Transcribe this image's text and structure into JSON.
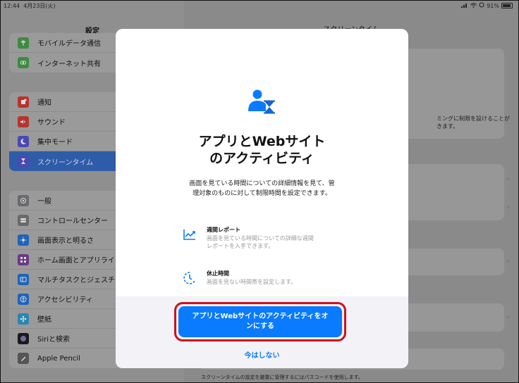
{
  "status_bar": {
    "time": "12:44",
    "date": "4月23日(火)",
    "battery": "91%"
  },
  "sidebar": {
    "title": "設定",
    "group1": [
      {
        "label": "モバイルデータ通信",
        "icon": "antenna-icon",
        "color": "#4caf50"
      },
      {
        "label": "インターネット共有",
        "icon": "link-icon",
        "color": "#4caf50"
      }
    ],
    "group2": [
      {
        "label": "通知",
        "icon": "bell-icon",
        "color": "#e53935"
      },
      {
        "label": "サウンド",
        "icon": "speaker-icon",
        "color": "#e53935"
      },
      {
        "label": "集中モード",
        "icon": "moon-icon",
        "color": "#5e5ce6"
      },
      {
        "label": "スクリーンタイム",
        "icon": "hourglass-icon",
        "color": "#5e5ce6",
        "selected": true
      }
    ],
    "group3": [
      {
        "label": "一般",
        "icon": "gear-icon",
        "color": "#8e8e93"
      },
      {
        "label": "コントロールセンター",
        "icon": "toggles-icon",
        "color": "#8e8e93"
      },
      {
        "label": "画面表示と明るさ",
        "icon": "sun-icon",
        "color": "#0a84ff"
      },
      {
        "label": "ホーム画面とアプリライブラリ",
        "icon": "grid-icon",
        "color": "#8e44ad"
      },
      {
        "label": "マルチタスクとジェスチャ",
        "icon": "multitask-icon",
        "color": "#0a84ff"
      },
      {
        "label": "アクセシビリティ",
        "icon": "accessibility-icon",
        "color": "#0a84ff"
      },
      {
        "label": "壁紙",
        "icon": "flower-icon",
        "color": "#32ade6"
      },
      {
        "label": "Siriと検索",
        "icon": "siri-icon",
        "color": "#222222"
      },
      {
        "label": "Apple Pencil",
        "icon": "pencil-icon",
        "color": "#8e8e93"
      }
    ]
  },
  "right_pane": {
    "title": "スクリーンタイム",
    "description_line1": "ミングに制限を設けることが",
    "description_line2": "きます。",
    "footnote": "スクリーンタイムの設定を厳重に管理するにはパスコードを使用します。"
  },
  "modal": {
    "title_line1": "アプリとWebサイト",
    "title_line2": "のアクティビティ",
    "description_line1": "画面を見ている時間についての詳細情報を見て、管",
    "description_line2": "理対象のものに対して制限時間を設定できます。",
    "features": [
      {
        "title": "週間レポート",
        "desc_line1": "画面を見ている時間についての詳細な週間",
        "desc_line2": "レポートを入手できます。",
        "icon": "chart-icon"
      },
      {
        "title": "休止時間",
        "desc_line1": "画面を見ない時間帯を設定します。",
        "desc_line2": "",
        "icon": "downtime-icon"
      }
    ],
    "primary_button_line1": "アプリとWebサイトのアクティビティをオ",
    "primary_button_line2": "ンにする",
    "secondary_button": "今はしない",
    "accent_color": "#0a7aff",
    "highlight_color": "#d0101f"
  }
}
